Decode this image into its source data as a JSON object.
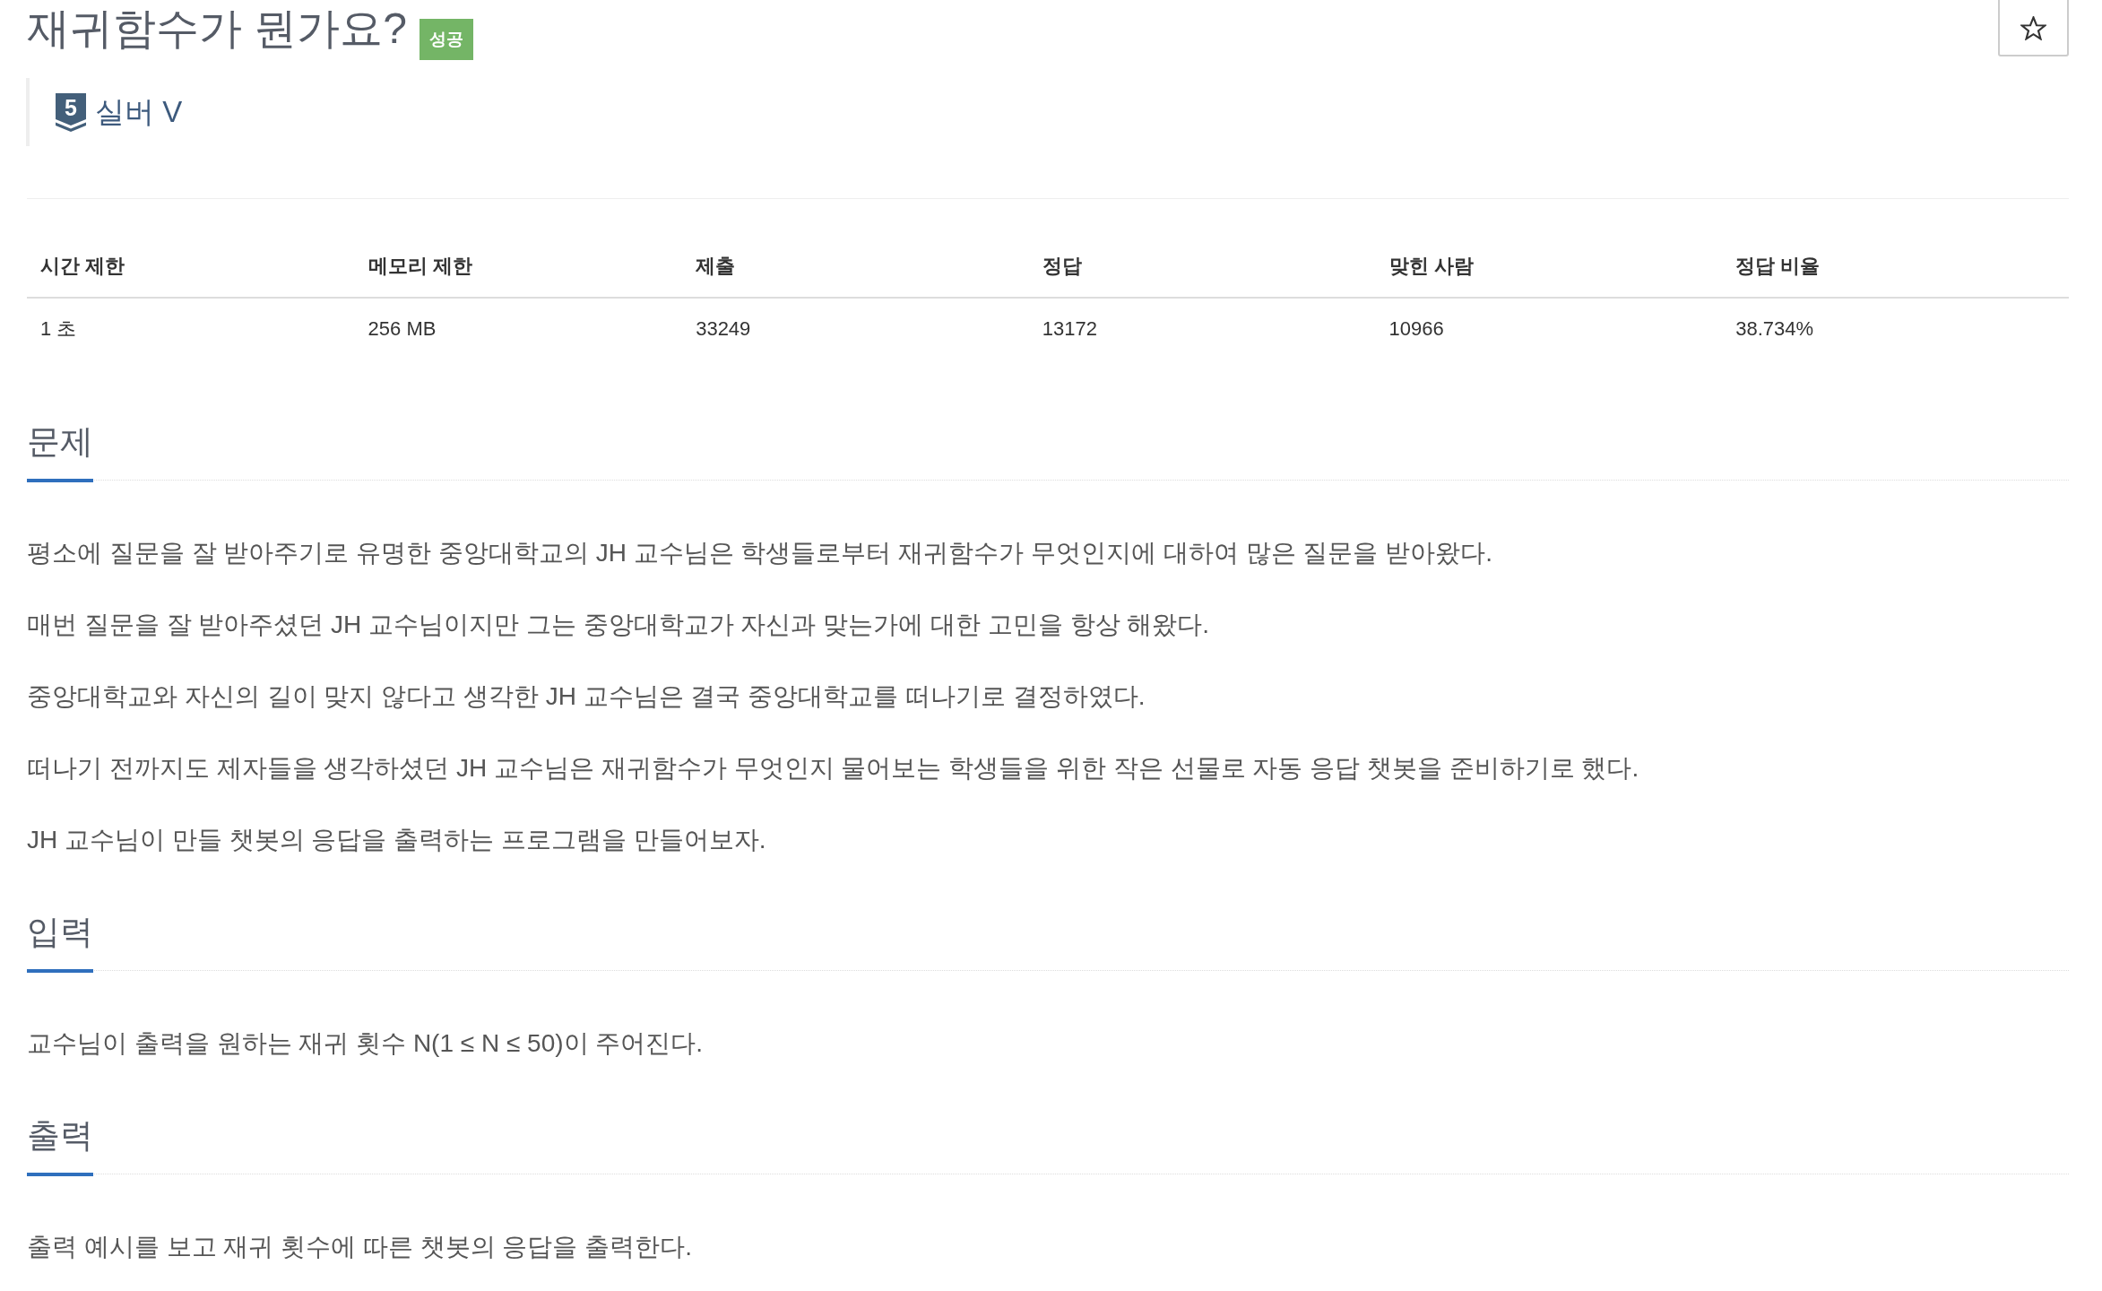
{
  "title": "재귀함수가 뭔가요?",
  "result_badge": "성공",
  "favorite": {
    "starred": false
  },
  "tier": {
    "number": "5",
    "name": "실버 V"
  },
  "stats_table": {
    "columns": [
      "시간 제한",
      "메모리 제한",
      "제출",
      "정답",
      "맞힌 사람",
      "정답 비율"
    ],
    "rows": [
      [
        "1 초",
        "256 MB",
        "33249",
        "13172",
        "10966",
        "38.734%"
      ]
    ]
  },
  "sections": [
    {
      "heading": "문제",
      "paragraphs": [
        "평소에 질문을 잘 받아주기로 유명한 중앙대학교의 JH 교수님은 학생들로부터 재귀함수가 무엇인지에 대하여 많은 질문을 받아왔다.",
        "매번 질문을 잘 받아주셨던 JH 교수님이지만 그는 중앙대학교가 자신과 맞는가에 대한 고민을 항상 해왔다.",
        "중앙대학교와 자신의 길이 맞지 않다고 생각한 JH 교수님은 결국 중앙대학교를 떠나기로 결정하였다.",
        "떠나기 전까지도 제자들을 생각하셨던 JH 교수님은 재귀함수가 무엇인지 물어보는 학생들을 위한 작은 선물로 자동 응답 챗봇을 준비하기로 했다.",
        "JH 교수님이 만들 챗봇의 응답을 출력하는 프로그램을 만들어보자."
      ]
    },
    {
      "heading": "입력",
      "paragraphs": [
        "교수님이 출력을 원하는 재귀 횟수 N(1 ≤ N ≤ 50)이 주어진다."
      ]
    },
    {
      "heading": "출력",
      "paragraphs": [
        "출력 예시를 보고 재귀 횟수에 따른 챗봇의 응답을 출력한다."
      ]
    }
  ]
}
